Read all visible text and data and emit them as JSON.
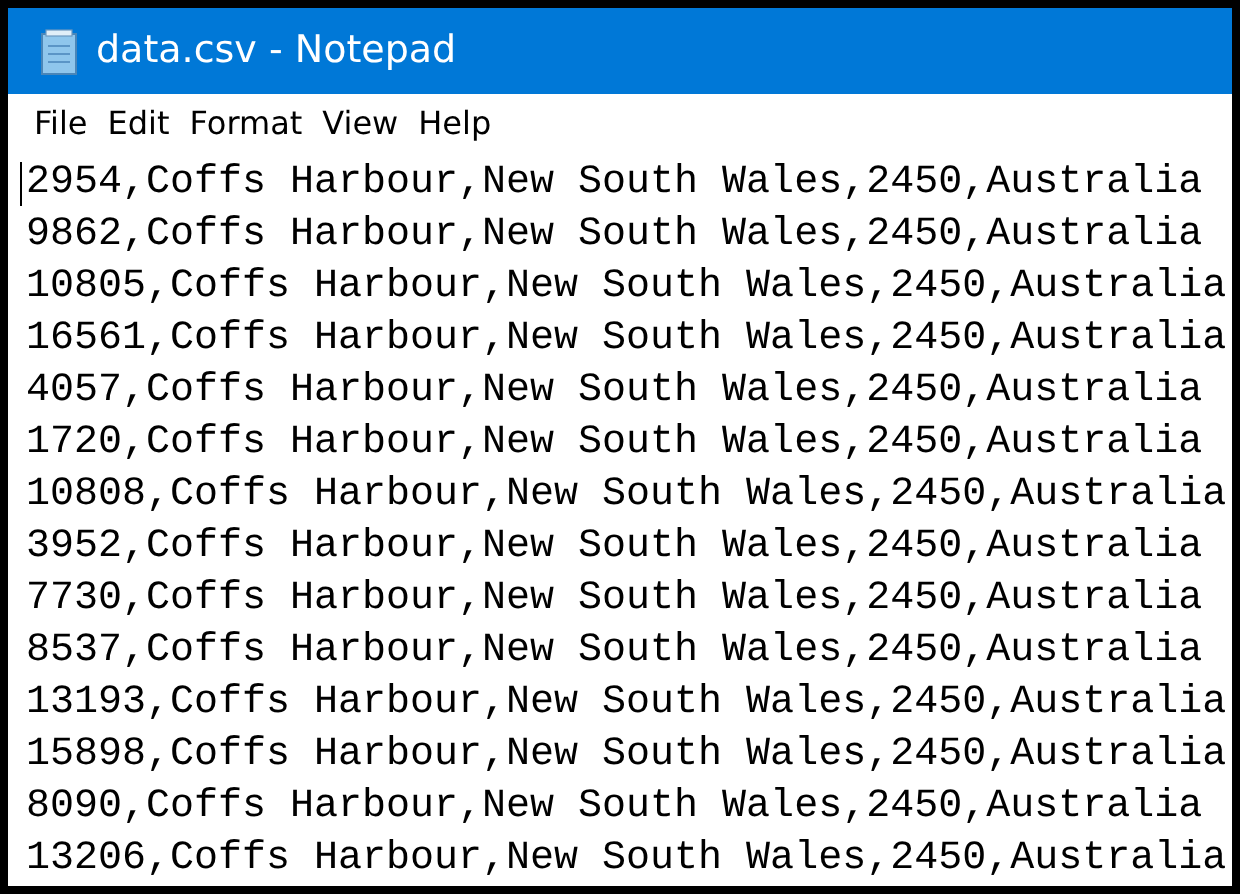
{
  "window": {
    "title": "data.csv - Notepad"
  },
  "menu": [
    "File",
    "Edit",
    "Format",
    "View",
    "Help"
  ],
  "lines": [
    "2954,Coffs Harbour,New South Wales,2450,Australia",
    "9862,Coffs Harbour,New South Wales,2450,Australia",
    "10805,Coffs Harbour,New South Wales,2450,Australia",
    "16561,Coffs Harbour,New South Wales,2450,Australia",
    "4057,Coffs Harbour,New South Wales,2450,Australia",
    "1720,Coffs Harbour,New South Wales,2450,Australia",
    "10808,Coffs Harbour,New South Wales,2450,Australia",
    "3952,Coffs Harbour,New South Wales,2450,Australia",
    "7730,Coffs Harbour,New South Wales,2450,Australia",
    "8537,Coffs Harbour,New South Wales,2450,Australia",
    "13193,Coffs Harbour,New South Wales,2450,Australia",
    "15898,Coffs Harbour,New South Wales,2450,Australia",
    "8090,Coffs Harbour,New South Wales,2450,Australia",
    "13206,Coffs Harbour,New South Wales,2450,Australia"
  ]
}
